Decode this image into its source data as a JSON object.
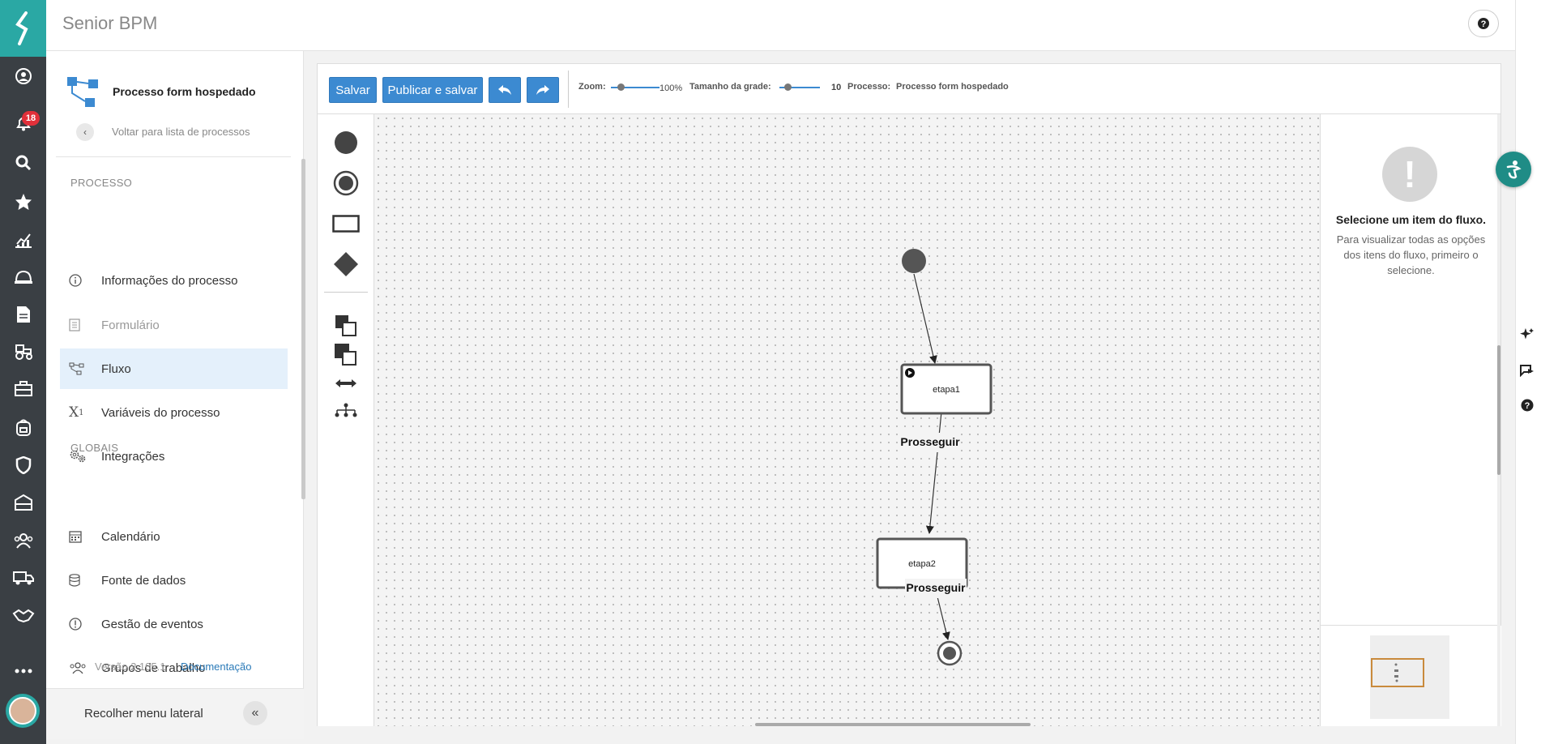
{
  "app": {
    "title": "Senior BPM"
  },
  "rail": {
    "notifications_count": "18",
    "icons": [
      "user-circle-icon",
      "bell-icon",
      "search-icon",
      "star-icon",
      "chart-icon",
      "helmet-icon",
      "document-icon",
      "tractor-icon",
      "briefcase-icon",
      "backpack-icon",
      "shield-icon",
      "building-icon",
      "team-icon",
      "truck-icon",
      "handshake-icon",
      "more-icon"
    ]
  },
  "sidebar": {
    "process_name": "Processo form hospedado",
    "back_label": "Voltar para lista de processos",
    "section_process": "PROCESSO",
    "section_globals": "GLOBAIS",
    "process_items": [
      {
        "label": "Informações do processo",
        "icon": "info-icon"
      },
      {
        "label": "Formulário",
        "icon": "form-icon"
      },
      {
        "label": "Fluxo",
        "icon": "flow-icon"
      },
      {
        "label": "Variáveis do processo",
        "icon": "variable-icon"
      },
      {
        "label": "Integrações",
        "icon": "gears-icon"
      }
    ],
    "global_items": [
      {
        "label": "Calendário",
        "icon": "calendar-icon"
      },
      {
        "label": "Fonte de dados",
        "icon": "database-icon"
      },
      {
        "label": "Gestão de eventos",
        "icon": "alert-circle-icon"
      },
      {
        "label": "Grupos de trabalho",
        "icon": "group-icon"
      }
    ],
    "version": "Versão 2.105.1",
    "docs_link": "Documentação",
    "collapse_label": "Recolher menu lateral"
  },
  "toolbar": {
    "save": "Salvar",
    "publish": "Publicar e salvar",
    "zoom_label": "Zoom:",
    "zoom_value": "100%",
    "zoom_fraction": 0.2,
    "grid_label": "Tamanho da grade:",
    "grid_value": "10",
    "grid_fraction": 0.2,
    "process_label": "Processo:",
    "process_value": "Processo form hospedado"
  },
  "flow": {
    "nodes": [
      {
        "id": "start",
        "type": "start"
      },
      {
        "id": "etapa1",
        "type": "task",
        "label": "etapa1",
        "has_start_marker": true
      },
      {
        "id": "etapa2",
        "type": "task",
        "label": "etapa2"
      },
      {
        "id": "end",
        "type": "end"
      }
    ],
    "edges": [
      {
        "from": "start",
        "to": "etapa1",
        "label": ""
      },
      {
        "from": "etapa1",
        "to": "etapa2",
        "label": "Prosseguir"
      },
      {
        "from": "etapa2",
        "to": "end",
        "label": "Prosseguir"
      }
    ]
  },
  "properties": {
    "title": "Selecione um item do fluxo.",
    "description": "Para visualizar todas as opções dos itens do fluxo, primeiro o selecione."
  },
  "colors": {
    "accent": "#3c8ad1",
    "rail": "#3a3f44",
    "brand": "#2aa8a4",
    "active_bg": "#e4f0fb"
  }
}
